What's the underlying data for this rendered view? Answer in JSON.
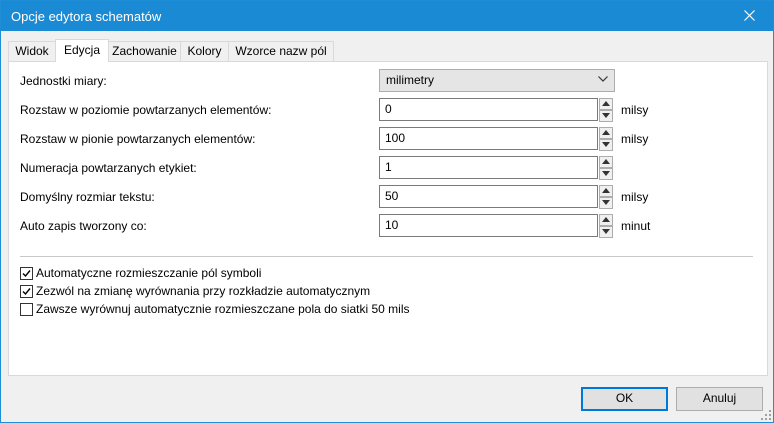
{
  "window": {
    "title": "Opcje edytora schematów"
  },
  "tabs": [
    {
      "label": "Widok",
      "active": false
    },
    {
      "label": "Edycja",
      "active": true
    },
    {
      "label": "Zachowanie",
      "active": false
    },
    {
      "label": "Kolory",
      "active": false
    },
    {
      "label": "Wzorce nazw pól",
      "active": false
    }
  ],
  "units": {
    "label": "Jednostki miary:",
    "value": "milimetry"
  },
  "fields": [
    {
      "label": "Rozstaw w poziomie powtarzanych elementów:",
      "value": "0",
      "unit": "milsy"
    },
    {
      "label": "Rozstaw w pionie powtarzanych elementów:",
      "value": "100",
      "unit": "milsy"
    },
    {
      "label": "Numeracja powtarzanych etykiet:",
      "value": "1",
      "unit": ""
    },
    {
      "label": "Domyślny rozmiar tekstu:",
      "value": "50",
      "unit": "milsy"
    },
    {
      "label": "Auto zapis tworzony co:",
      "value": "10",
      "unit": "minut"
    }
  ],
  "checkboxes": [
    {
      "label": "Automatyczne rozmieszczanie pól symboli",
      "checked": true
    },
    {
      "label": "Zezwól na zmianę wyrównania przy rozkładzie automatycznym",
      "checked": true
    },
    {
      "label": "Zawsze wyrównuj automatycznie rozmieszczane pola do siatki 50 mils",
      "checked": false
    }
  ],
  "buttons": {
    "ok": "OK",
    "cancel": "Anuluj"
  },
  "colors": {
    "titlebar": "#1a8ad4",
    "accent": "#0078d7"
  }
}
